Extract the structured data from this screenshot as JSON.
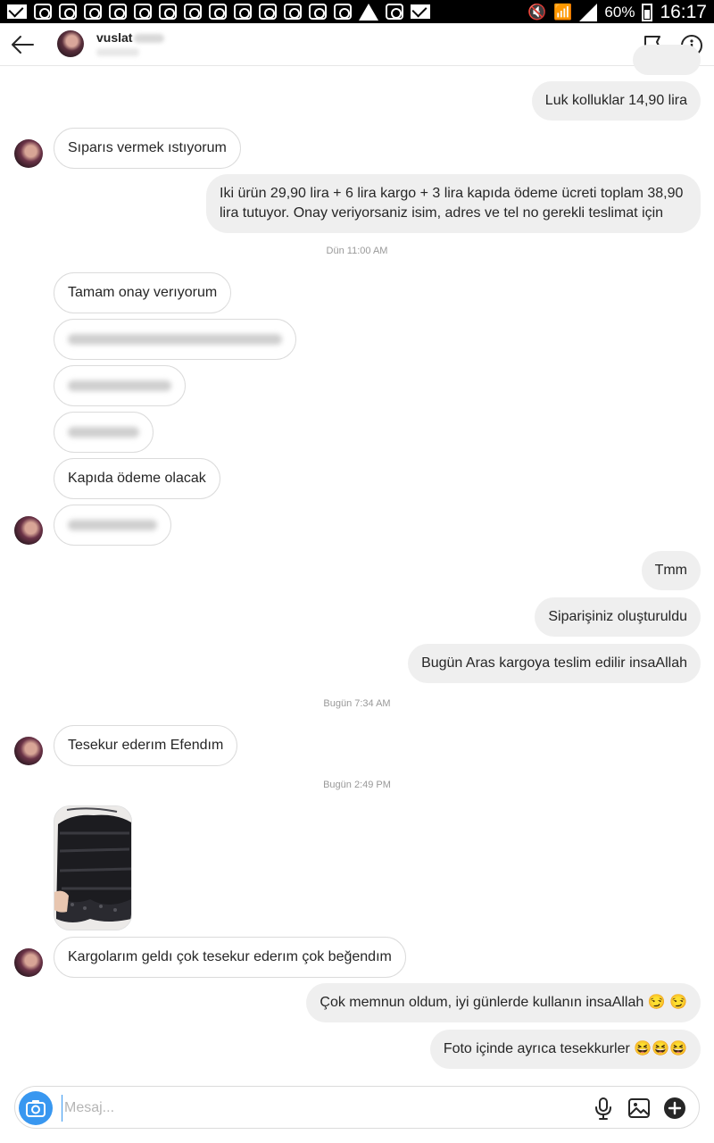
{
  "status_bar": {
    "battery": "60%",
    "time": "16:17",
    "notification_icons": [
      "mail-icon",
      "instagram-icon",
      "instagram-icon",
      "instagram-icon",
      "instagram-icon",
      "instagram-icon",
      "instagram-icon",
      "instagram-icon",
      "instagram-icon",
      "instagram-icon",
      "instagram-icon",
      "instagram-icon",
      "instagram-icon",
      "instagram-icon",
      "warning-icon",
      "image-icon",
      "gmail-icon"
    ]
  },
  "header": {
    "username": "vuslat",
    "back_icon": "back-arrow-icon",
    "flag_icon": "flag-icon",
    "info_icon": "info-icon"
  },
  "messages": [
    {
      "id": "m1",
      "side": "out",
      "text": "Luk kolluklar 14,90 lira"
    },
    {
      "id": "m2",
      "side": "in",
      "text": "Sıparıs vermek ıstıyorum"
    },
    {
      "id": "m3",
      "side": "out",
      "text": "Iki ürün 29,90 lira + 6 lira kargo + 3 lira kapıda ödeme ücreti toplam 38,90 lira tutuyor. Onay veriyorsaniz isim, adres ve tel no gerekli teslimat için"
    },
    {
      "id": "t1",
      "type": "timestamp",
      "text": "Dün 11:00 AM"
    },
    {
      "id": "m4",
      "side": "in",
      "text": "Tamam onay verıyorum"
    },
    {
      "id": "m5",
      "side": "in",
      "blurred": true
    },
    {
      "id": "m6",
      "side": "in",
      "blurred": true
    },
    {
      "id": "m7",
      "side": "in",
      "blurred": true
    },
    {
      "id": "m8",
      "side": "in",
      "text": "Kapıda ödeme olacak"
    },
    {
      "id": "m9",
      "side": "in",
      "blurred": true
    },
    {
      "id": "m10",
      "side": "out",
      "text": "Tmm"
    },
    {
      "id": "m11",
      "side": "out",
      "text": "Siparişiniz oluşturuldu"
    },
    {
      "id": "m12",
      "side": "out",
      "text": "Bugün Aras kargoya teslim edilir insaAllah"
    },
    {
      "id": "t2",
      "type": "timestamp",
      "text": "Bugün 7:34 AM"
    },
    {
      "id": "m13",
      "side": "in",
      "text": "Tesekur ederım Efendım"
    },
    {
      "id": "t3",
      "type": "timestamp",
      "text": "Bugün 2:49 PM"
    },
    {
      "id": "m14",
      "side": "in",
      "type": "photo"
    },
    {
      "id": "m15",
      "side": "in",
      "text": "Kargolarım geldı çok tesekur ederım çok beğendım"
    },
    {
      "id": "m16",
      "side": "out",
      "text": "Çok memnun oldum, iyi günlerde kullanın insaAllah 😏 😏"
    },
    {
      "id": "m17",
      "side": "out",
      "text": "Foto içinde ayrıca tesekkurler 😆😆😆"
    }
  ],
  "composer": {
    "placeholder": "Mesaj...",
    "camera_icon": "camera-icon",
    "mic_icon": "microphone-icon",
    "gallery_icon": "gallery-icon",
    "plus_icon": "plus-icon"
  },
  "colors": {
    "accent": "#3897f0",
    "incoming_border": "#dbdbdb",
    "outgoing_bg": "#efefef"
  }
}
